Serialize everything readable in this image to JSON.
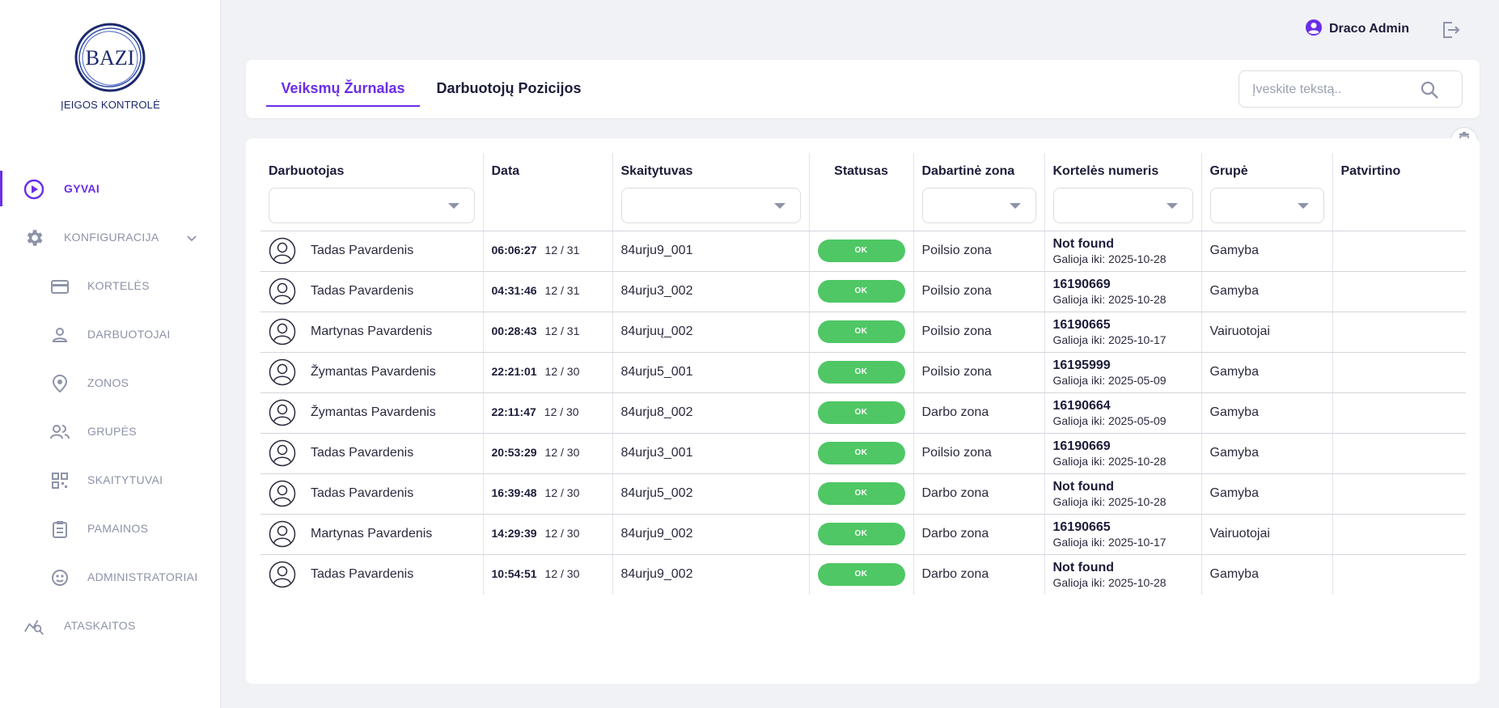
{
  "sidebar": {
    "logo_text": "BAZI",
    "logo_caption": "ĮEIGOS KONTROLĖ",
    "items": [
      {
        "label": "GYVAI",
        "icon": "play-circle-icon",
        "active": true
      },
      {
        "label": "KONFIGURACIJA",
        "icon": "gear-icon"
      },
      {
        "label": "KORTELĖS",
        "icon": "credit-card-icon"
      },
      {
        "label": "DARBUOTOJAI",
        "icon": "person-icon"
      },
      {
        "label": "ZONOS",
        "icon": "location-pin-icon"
      },
      {
        "label": "GRUPĖS",
        "icon": "group-icon"
      },
      {
        "label": "SKAITYTUVAI",
        "icon": "qr-code-icon"
      },
      {
        "label": "PAMAINOS",
        "icon": "clipboard-icon"
      },
      {
        "label": "ADMINISTRATORIAI",
        "icon": "admin-face-icon"
      },
      {
        "label": "ATASKAITOS",
        "icon": "chart-search-icon"
      }
    ]
  },
  "topbar": {
    "user_name": "Draco Admin"
  },
  "tabs": [
    {
      "label": "Veiksmų Žurnalas",
      "active": true
    },
    {
      "label": "Darbuotojų Pozicijos",
      "active": false
    }
  ],
  "search": {
    "placeholder": "Įveskite tekstą.."
  },
  "table": {
    "headers": {
      "employee": "Darbuotojas",
      "date": "Data",
      "scanner": "Skaitytuvas",
      "status": "Statusas",
      "zone": "Dabartinė zona",
      "card": "Kortelės numeris",
      "group": "Grupė",
      "confirmed": "Patvirtino"
    },
    "rows": [
      {
        "employee": "Tadas Pavardenis",
        "time": "06:06:27",
        "date": "12 / 31",
        "scanner": "84urju9_001",
        "status": "OK",
        "zone": "Poilsio zona",
        "card": "Not found",
        "valid": "Galioja iki: 2025-10-28",
        "group": "Gamyba",
        "confirmed": ""
      },
      {
        "employee": "Tadas Pavardenis",
        "time": "04:31:46",
        "date": "12 / 31",
        "scanner": "84urju3_002",
        "status": "OK",
        "zone": "Poilsio zona",
        "card": "16190669",
        "valid": "Galioja iki: 2025-10-28",
        "group": "Gamyba",
        "confirmed": ""
      },
      {
        "employee": "Martynas Pavardenis",
        "time": "00:28:43",
        "date": "12 / 31",
        "scanner": "84urjuų_002",
        "status": "OK",
        "zone": "Poilsio zona",
        "card": "16190665",
        "valid": "Galioja iki: 2025-10-17",
        "group": "Vairuotojai",
        "confirmed": ""
      },
      {
        "employee": "Žymantas Pavardenis",
        "time": "22:21:01",
        "date": "12 / 30",
        "scanner": "84urju5_001",
        "status": "OK",
        "zone": "Poilsio zona",
        "card": "16195999",
        "valid": "Galioja iki: 2025-05-09",
        "group": "Gamyba",
        "confirmed": ""
      },
      {
        "employee": "Žymantas Pavardenis",
        "time": "22:11:47",
        "date": "12 / 30",
        "scanner": "84urju8_002",
        "status": "OK",
        "zone": "Darbo zona",
        "card": "16190664",
        "valid": "Galioja iki: 2025-05-09",
        "group": "Gamyba",
        "confirmed": ""
      },
      {
        "employee": "Tadas Pavardenis",
        "time": "20:53:29",
        "date": "12 / 30",
        "scanner": "84urju3_001",
        "status": "OK",
        "zone": "Poilsio zona",
        "card": "16190669",
        "valid": "Galioja iki: 2025-10-28",
        "group": "Gamyba",
        "confirmed": ""
      },
      {
        "employee": "Tadas Pavardenis",
        "time": "16:39:48",
        "date": "12 / 30",
        "scanner": "84urju5_002",
        "status": "OK",
        "zone": "Darbo zona",
        "card": "Not found",
        "valid": "Galioja iki: 2025-10-28",
        "group": "Gamyba",
        "confirmed": ""
      },
      {
        "employee": "Martynas Pavardenis",
        "time": "14:29:39",
        "date": "12 / 30",
        "scanner": "84urju9_002",
        "status": "OK",
        "zone": "Darbo zona",
        "card": "16190665",
        "valid": "Galioja iki: 2025-10-17",
        "group": "Vairuotojai",
        "confirmed": ""
      },
      {
        "employee": "Tadas Pavardenis",
        "time": "10:54:51",
        "date": "12 / 30",
        "scanner": "84urju9_002",
        "status": "OK",
        "zone": "Darbo zona",
        "card": "Not found",
        "valid": "Galioja iki: 2025-10-28",
        "group": "Gamyba",
        "confirmed": ""
      }
    ]
  },
  "colors": {
    "accent": "#6a2ee8",
    "status_ok": "#4fc765",
    "brand": "#1c2a6e"
  }
}
